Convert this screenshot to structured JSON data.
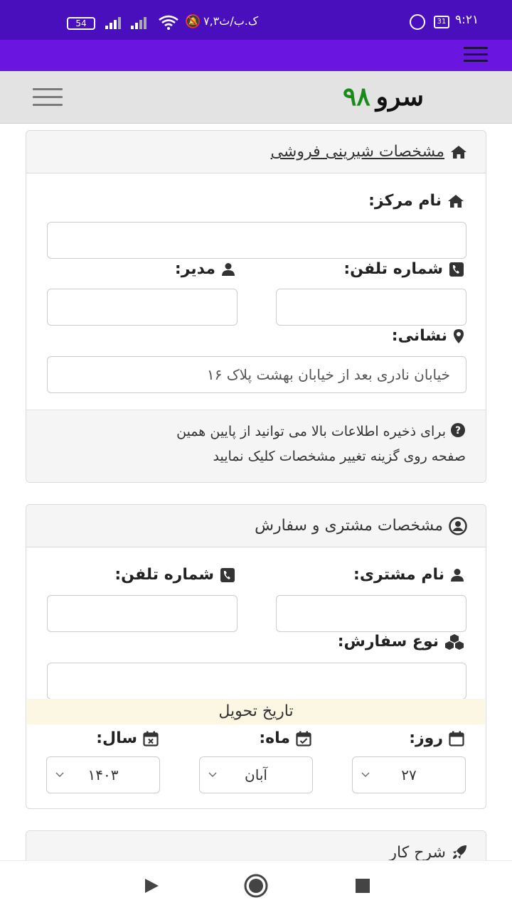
{
  "status_bar": {
    "time": "۹:۲۱",
    "calendar_day": "31",
    "network_speed": "۷,۳ک.ب/ث",
    "battery": "54"
  },
  "header": {
    "brand_name": "سرو",
    "brand_number": "۹۸"
  },
  "shop_panel": {
    "title": "مشخصات شیرینی فروشی",
    "center_name_label": "نام مرکز:",
    "phone_label": "شماره تلفن:",
    "manager_label": "مدیر:",
    "address_label": "نشانی:",
    "address_value": "خیابان نادری بعد از خیابان بهشت پلاک ۱۶",
    "note_line1": "برای ذخیره اطلاعات بالا می توانید از پایین همین",
    "note_line2": "صفحه روی گزینه تغییر مشخصات کلیک نمایید"
  },
  "order_panel": {
    "title": "مشخصات مشتری و سفارش",
    "customer_name_label": "نام مشتری:",
    "customer_phone_label": "شماره تلفن:",
    "order_type_label": "نوع سفارش:",
    "delivery_date_title": "تاریخ تحویل",
    "day_label": "روز:",
    "month_label": "ماه:",
    "year_label": "سال:",
    "day_value": "۲۷",
    "month_value": "آبان",
    "year_value": "۱۴۰۳"
  },
  "work_panel": {
    "title": "شرح کار"
  },
  "colors": {
    "status_bar": "#4a0fbd",
    "app_bar": "#6a16e0",
    "brand_number": "#1a8a1a",
    "panel_header": "#f5f5f5",
    "date_banner": "#fcf7e2"
  }
}
